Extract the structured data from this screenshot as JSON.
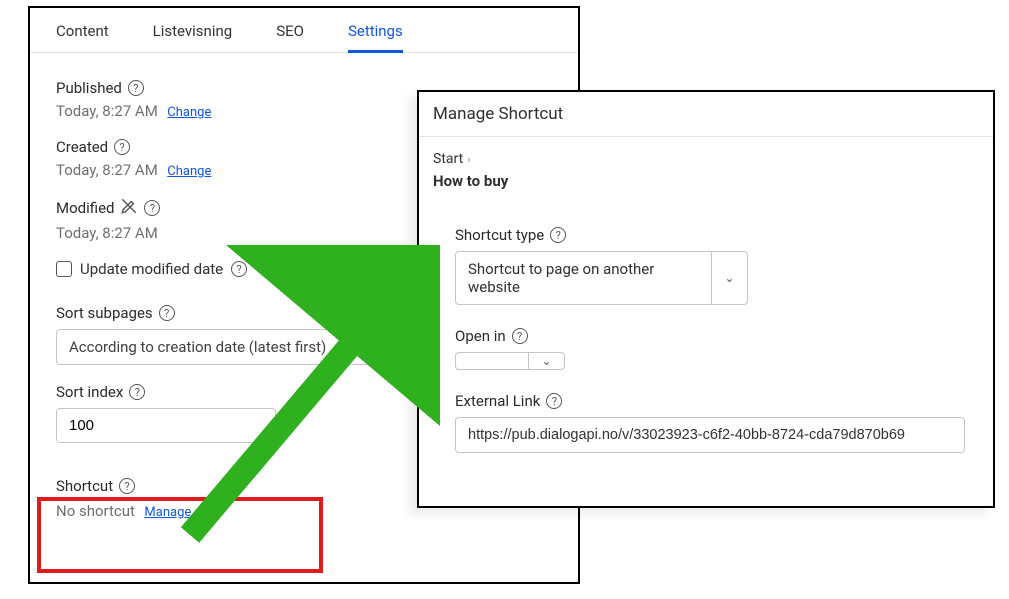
{
  "tabs": [
    "Content",
    "Listevisning",
    "SEO",
    "Settings"
  ],
  "activeTab": "Settings",
  "published": {
    "label": "Published",
    "value": "Today, 8:27 AM",
    "action": "Change"
  },
  "created": {
    "label": "Created",
    "value": "Today, 8:27 AM",
    "action": "Change"
  },
  "modified": {
    "label": "Modified",
    "value": "Today, 8:27 AM"
  },
  "updateModified": {
    "label": "Update modified date"
  },
  "sortSubpages": {
    "label": "Sort subpages",
    "value": "According to creation date (latest first)"
  },
  "sortIndex": {
    "label": "Sort index",
    "value": "100"
  },
  "shortcut": {
    "label": "Shortcut",
    "status": "No shortcut",
    "action": "Manage"
  },
  "dialog": {
    "title": "Manage Shortcut",
    "breadcrumb": "Start",
    "page": "How to buy",
    "shortcutType": {
      "label": "Shortcut type",
      "value": "Shortcut to page on another website"
    },
    "openIn": {
      "label": "Open in",
      "value": ""
    },
    "externalLink": {
      "label": "External Link",
      "value": "https://pub.dialogapi.no/v/33023923-c6f2-40bb-8724-cda79d870b69"
    }
  }
}
